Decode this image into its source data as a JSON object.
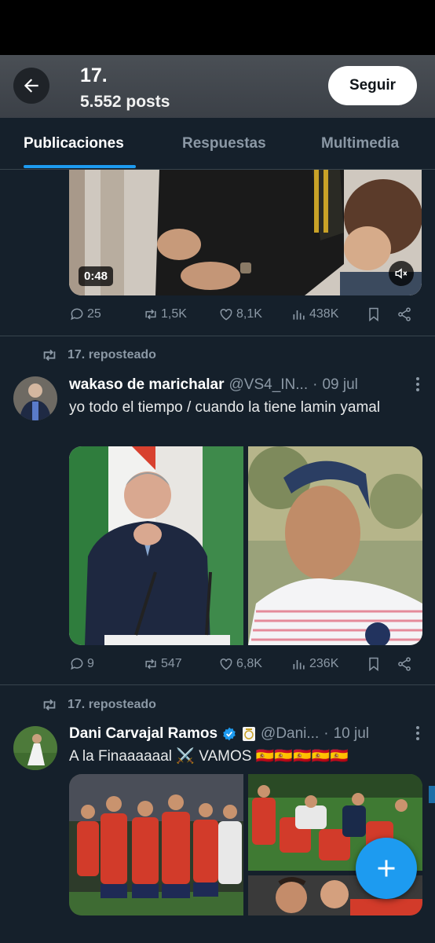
{
  "header": {
    "title": "17.",
    "post_count": "5.552 posts",
    "follow_label": "Seguir"
  },
  "tabs": [
    {
      "label": "Publicaciones",
      "active": true
    },
    {
      "label": "Respuestas",
      "active": false
    },
    {
      "label": "Multimedia",
      "active": false
    }
  ],
  "tweet1": {
    "video_duration": "0:48",
    "replies": "25",
    "reposts": "1,5K",
    "likes": "8,1K",
    "views": "438K"
  },
  "tweet2": {
    "repost_label": "17. reposteado",
    "name": "wakaso de marichalar",
    "handle": "@VS4_IN...",
    "date": "09 jul",
    "text": "yo todo el tiempo / cuando la tiene lamin yamal",
    "replies": "9",
    "reposts": "547",
    "likes": "6,8K",
    "views": "236K"
  },
  "tweet3": {
    "repost_label": "17. reposteado",
    "name": "Dani Carvajal Ramos",
    "handle": "@Dani...",
    "date": "10 jul",
    "text": "A la Finaaaaaal ⚔️ VAMOS 🇪🇸🇪🇸🇪🇸🇪🇸🇪🇸"
  },
  "icons": {
    "back": "arrow-left-icon",
    "reply": "chat-bubble-icon",
    "repost": "repost-arrows-icon",
    "like": "heart-icon",
    "views": "bar-chart-icon",
    "bookmark": "bookmark-icon",
    "share": "share-icon",
    "verified": "verified-badge-icon",
    "compose": "plus-icon"
  },
  "colors": {
    "accent": "#1d9bf0",
    "background": "#15202b",
    "muted": "#8b98a5"
  }
}
